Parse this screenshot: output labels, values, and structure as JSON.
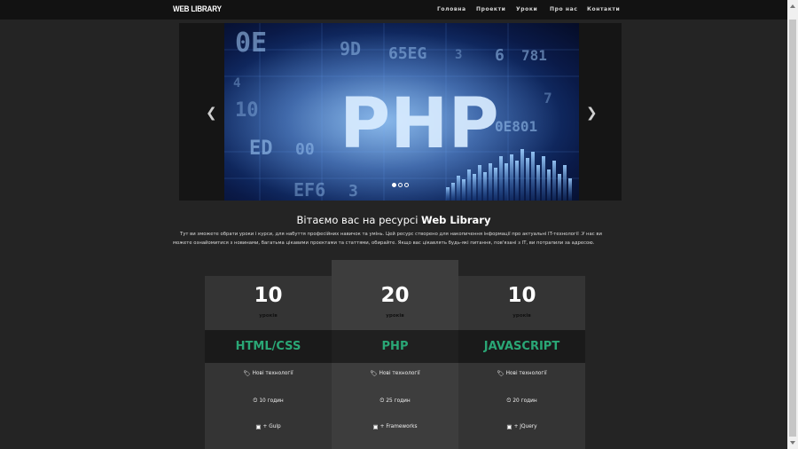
{
  "brand": "WEB LIBRARY",
  "nav": [
    {
      "label": "Головна"
    },
    {
      "label": "Проекти"
    },
    {
      "label": "Уроки"
    },
    {
      "label": "Про нас"
    },
    {
      "label": "Контакти"
    }
  ],
  "carousel": {
    "prev_glyph": "❮",
    "next_glyph": "❯",
    "slide_text": "PHP",
    "slide_bg_texts": [
      "0E",
      "9D",
      "65EG",
      "6",
      "781",
      "10",
      "ED",
      "00",
      "0E801",
      "EF6",
      "3",
      "3",
      "7",
      "4"
    ],
    "slides_count": 3,
    "active_slide": 1
  },
  "welcome": {
    "title_prefix": "Вітаємо вас на ресурсі ",
    "title_brand": "Web Library",
    "text": "Тут ви зможете обрати уроки і курси, для набуття професійних навичок та умінь. Цей ресурс створено для накопичення інформації про актуальні IT-технології .У нас ви можете ознайомитися з новинами, багатьма цікавими проектами та статтями, обирайте. Якщо вас цікавлять будь-які питання, пов'язані з IT, ви потрапили за адресою."
  },
  "courses": [
    {
      "count": "10",
      "unit": "уроків",
      "name": "HTML/CSS",
      "tag": "Нові технології",
      "hours": "10 годин",
      "extra": "+ Gulp"
    },
    {
      "count": "20",
      "unit": "уроків",
      "name": "PHP",
      "tag": "Нові технології",
      "hours": "25 годин",
      "extra": "+ Frameworks"
    },
    {
      "count": "10",
      "unit": "уроків",
      "name": "JAVASCRIPT",
      "tag": "Нові технології",
      "hours": "20 годин",
      "extra": "+ JQuery"
    }
  ],
  "icons": {
    "tag": "tags-icon",
    "clock": "clock-icon",
    "extra": "cube-icon"
  },
  "colors": {
    "accent": "#2aa776",
    "navbar": "#121212",
    "background": "#242424"
  }
}
